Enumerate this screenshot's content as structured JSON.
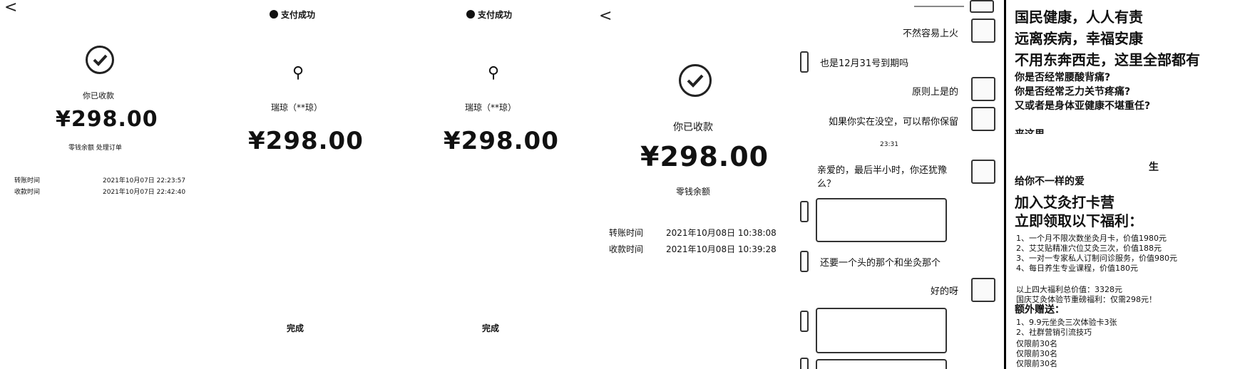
{
  "p1": {
    "back": "<",
    "title": "你已收款",
    "amount": "¥298.00",
    "links": "零钱余额  处理订单",
    "rows": [
      {
        "label": "转账时间",
        "value": "2021年10月07日 22:23:57"
      },
      {
        "label": "收款时间",
        "value": "2021年10月07日 22:42:40"
      }
    ]
  },
  "p2": {
    "status": "支付成功",
    "name": "瑞琼（**琼）",
    "amount": "¥298.00",
    "done": "完成"
  },
  "p3": {
    "status": "支付成功",
    "name": "瑞琼（**琼）",
    "amount": "¥298.00",
    "done": "完成"
  },
  "p4": {
    "back": "<",
    "title": "你已收款",
    "amount": "¥298.00",
    "link": "零钱余额",
    "rows": [
      {
        "label": "转账时间",
        "value": "2021年10月08日 10:38:08"
      },
      {
        "label": "收款时间",
        "value": "2021年10月08日 10:39:28"
      }
    ]
  },
  "chat": {
    "messages": [
      {
        "side": "right",
        "text": "不然容易上火"
      },
      {
        "side": "left",
        "text": "也是12月31号到期吗"
      },
      {
        "side": "right",
        "text": "原则上是的"
      },
      {
        "side": "right",
        "text": "如果你实在没空，可以帮你保留"
      },
      {
        "side": "time",
        "text": "23:31"
      },
      {
        "side": "right",
        "text": "亲爱的，最后半小时，你还犹豫么？"
      },
      {
        "side": "left",
        "text": "还要一个头的那个和坐灸那个"
      },
      {
        "side": "right",
        "text": "好的呀"
      }
    ]
  },
  "ad": {
    "headline": [
      "国民健康，人人有责",
      "远离疾病，幸福安康",
      "不用东奔西走，这里全部都有"
    ],
    "questions": [
      "你是否经常腰酸背痛?",
      "你是否经常乏力关节疼痛?",
      "又或者是身体亚健康不堪重任?"
    ],
    "cut": "来这里",
    "sheng": "生",
    "gift": "给你不一样的爱",
    "join": [
      "加入艾灸打卡营",
      "立即领取以下福利："
    ],
    "benefits": [
      "1、一个月不限次数坐灸月卡，价值1980元",
      "2、艾艾贴精准穴位艾灸三次，价值188元",
      "3、一对一专家私人订制问诊服务，价值980元",
      "4、每日养生专业课程，价值180元"
    ],
    "total": "以上四大福利总价值：3328元",
    "promo": "国庆艾灸体验节重磅福利：仅需298元！",
    "extra_title": "额外赠送：",
    "extras": [
      "1、9.9元坐灸三次体验卡3张",
      "2、社群营销引流技巧"
    ],
    "limits": [
      "仅限前30名",
      "仅限前30名",
      "仅限前30名"
    ]
  }
}
